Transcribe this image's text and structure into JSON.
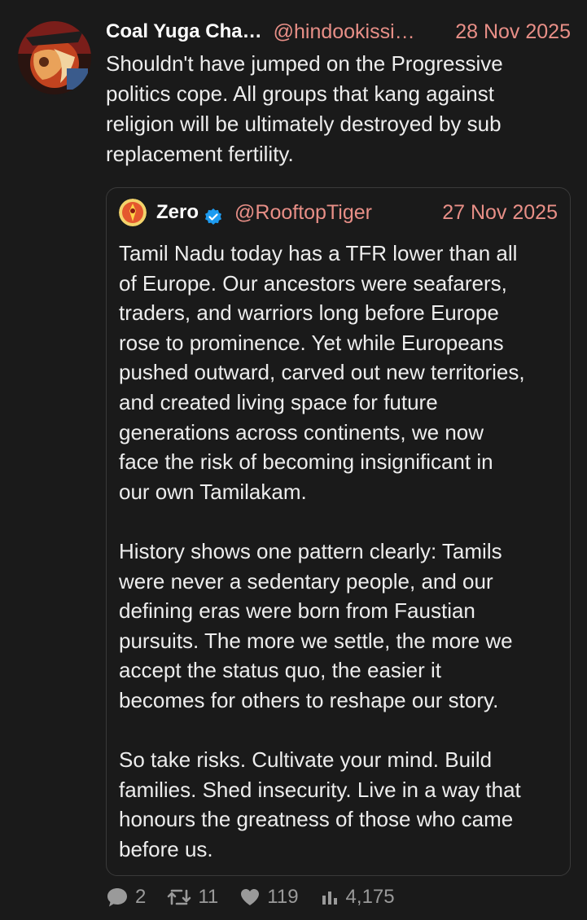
{
  "post": {
    "author_name": "Coal Yuga Cha…",
    "handle": "@hindookissi…",
    "date": "28 Nov 2025",
    "text": "Shouldn't have jumped on the Progressive\npolitics cope. All groups that kang against\nreligion will be ultimately destroyed by sub\nreplacement fertility."
  },
  "quote": {
    "author_name": "Zero",
    "handle": "@RooftopTiger",
    "date": "27 Nov 2025",
    "verified": true,
    "text": "Tamil Nadu today has a TFR lower than all\nof Europe. Our ancestors were seafarers,\ntraders, and warriors long before Europe\nrose to prominence. Yet while Europeans\npushed outward, carved out new territories,\nand created living space for future\ngenerations across continents, we now\nface the risk of becoming insignificant in\nour own Tamilakam.\n\nHistory shows one pattern clearly: Tamils\nwere never a sedentary people, and our\ndefining eras were born from Faustian\npursuits. The more we settle, the more we\naccept the status quo, the easier it\nbecomes for others to reshape our story.\n\nSo take risks. Cultivate your mind. Build\nfamilies. Shed insecurity. Live in a way that\nhonours the greatness of those who came\nbefore us."
  },
  "stats": {
    "replies": "2",
    "reposts": "11",
    "likes": "119",
    "views": "4,175"
  },
  "icons": {
    "reply": "speech-bubble-icon",
    "repost": "repost-arrows-icon",
    "like": "heart-icon",
    "views": "bar-chart-icon",
    "verified": "verified-check-icon"
  },
  "colors": {
    "background": "#1a1a1a",
    "accent": "#e88f87",
    "text": "#ededed",
    "muted": "#9a9a9a",
    "verified": "#1d9bf0"
  }
}
